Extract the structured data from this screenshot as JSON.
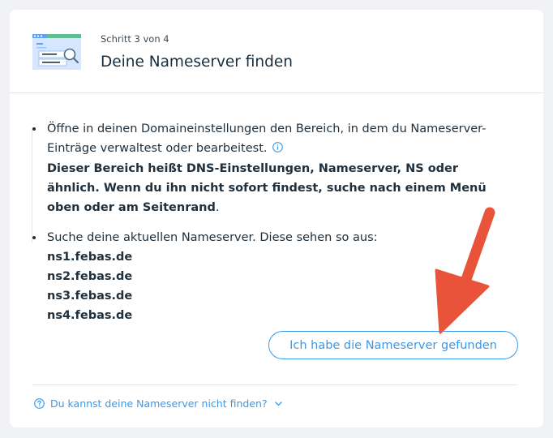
{
  "header": {
    "step": "Schritt 3 von 4",
    "title": "Deine Nameserver finden"
  },
  "steps": {
    "item1": {
      "text": "Öffne in deinen Domaineinstellungen den Bereich, in dem du Nameserver-Einträge verwaltest oder bearbeitest.",
      "bold": "Dieser Bereich heißt DNS-Einstellungen, Nameserver, NS oder ähnlich. Wenn du ihn nicht sofort findest, suche nach einem Menü oben oder am Seitenrand",
      "period": "."
    },
    "item2": {
      "text": "Suche deine aktuellen Nameserver. Diese sehen so aus:",
      "nameservers": [
        "ns1.febas.de",
        "ns2.febas.de",
        "ns3.febas.de",
        "ns4.febas.de"
      ]
    }
  },
  "found_button": "Ich habe die Nameserver gefunden",
  "help_link": "Du kannst deine Nameserver nicht finden?",
  "colors": {
    "accent": "#3899ec",
    "arrow": "#e8533a",
    "text": "#20303c"
  },
  "icons": [
    "browser-search-illustration",
    "info-icon",
    "question-icon",
    "chevron-down-icon",
    "arrow-annotation"
  ]
}
